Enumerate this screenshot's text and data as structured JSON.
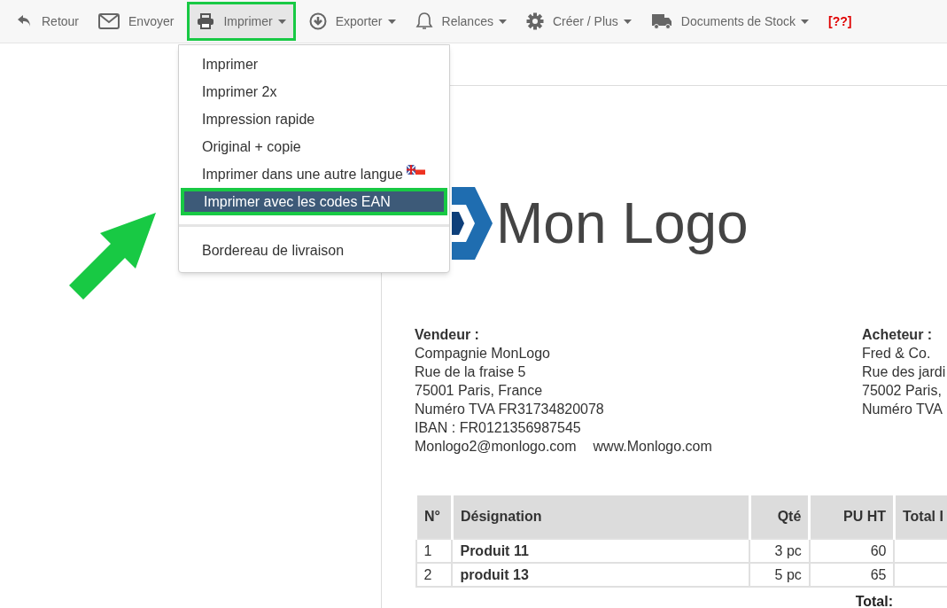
{
  "toolbar": [
    {
      "label": "Retour",
      "caret": false,
      "selected": false,
      "kind": "normal"
    },
    {
      "label": "Envoyer",
      "caret": false,
      "selected": false,
      "kind": "normal"
    },
    {
      "label": "Imprimer",
      "caret": true,
      "selected": true,
      "kind": "normal"
    },
    {
      "label": "Exporter",
      "caret": true,
      "selected": false,
      "kind": "normal"
    },
    {
      "label": "Relances",
      "caret": true,
      "selected": false,
      "kind": "normal"
    },
    {
      "label": "Créer / Plus",
      "caret": true,
      "selected": false,
      "kind": "normal"
    },
    {
      "label": "Documents de Stock",
      "caret": true,
      "selected": false,
      "kind": "normal"
    },
    {
      "label": "[??]",
      "caret": false,
      "selected": false,
      "kind": "warning"
    }
  ],
  "print_menu": [
    {
      "label": "Imprimer",
      "selected": false,
      "flag": false,
      "divider_before": false
    },
    {
      "label": "Imprimer 2x",
      "selected": false,
      "flag": false,
      "divider_before": false
    },
    {
      "label": "Impression rapide",
      "selected": false,
      "flag": false,
      "divider_before": false
    },
    {
      "label": "Original + copie",
      "selected": false,
      "flag": false,
      "divider_before": false
    },
    {
      "label": "Imprimer dans une autre langue",
      "selected": false,
      "flag": true,
      "divider_before": false
    },
    {
      "label": "Imprimer avec les codes EAN",
      "selected": true,
      "flag": false,
      "divider_before": false
    },
    {
      "label": "Bordereau de livraison",
      "selected": false,
      "flag": false,
      "divider_before": true
    }
  ],
  "document": {
    "logo_text": "Mon Logo",
    "seller": {
      "heading": "Vendeur :",
      "lines": [
        "Compagnie MonLogo",
        "Rue de la fraise 5",
        "75001 Paris, France",
        "Numéro TVA FR31734820078",
        "IBAN : FR0121356987545"
      ],
      "email": "Monlogo2@monlogo.com",
      "website": "www.Monlogo.com"
    },
    "buyer": {
      "heading": "Acheteur :",
      "lines": [
        "Fred & Co.",
        "Rue des jardi",
        "75002 Paris,",
        "Numéro TVA"
      ]
    },
    "table": {
      "columns": [
        "N°",
        "Désignation",
        "Qté",
        "PU HT",
        "Total I"
      ],
      "rows": [
        [
          "1",
          "Produit 11",
          "3 pc",
          "60",
          ""
        ],
        [
          "2",
          "produit 13",
          "5 pc",
          "65",
          ""
        ]
      ],
      "total_label": "Total:"
    }
  }
}
